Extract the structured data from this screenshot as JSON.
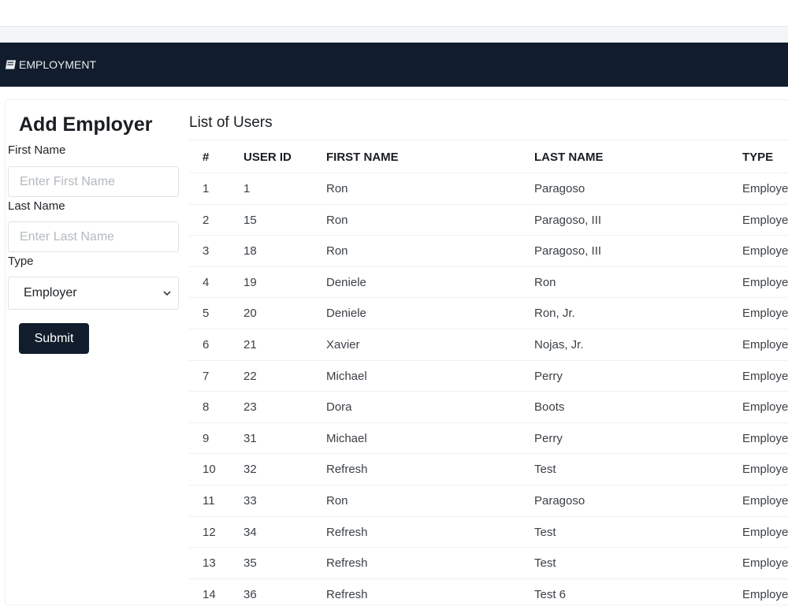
{
  "nav": {
    "brand": "EMPLOYMENT",
    "brand_icon": "book-icon"
  },
  "form": {
    "title": "Add Employer",
    "first_name_label": "First Name",
    "first_name_placeholder": "Enter First Name",
    "last_name_label": "Last Name",
    "last_name_placeholder": "Enter Last Name",
    "type_label": "Type",
    "type_value": "Employer",
    "submit_label": "Submit"
  },
  "list": {
    "title": "List of Users",
    "columns": [
      "#",
      "USER ID",
      "FIRST NAME",
      "LAST NAME",
      "TYPE"
    ],
    "rows": [
      [
        "1",
        "1",
        "Ron",
        "Paragoso",
        "Employee"
      ],
      [
        "2",
        "15",
        "Ron",
        "Paragoso, III",
        "Employee"
      ],
      [
        "3",
        "18",
        "Ron",
        "Paragoso, III",
        "Employee"
      ],
      [
        "4",
        "19",
        "Deniele",
        "Ron",
        "Employee"
      ],
      [
        "5",
        "20",
        "Deniele",
        "Ron, Jr.",
        "Employee"
      ],
      [
        "6",
        "21",
        "Xavier",
        "Nojas, Jr.",
        "Employee"
      ],
      [
        "7",
        "22",
        "Michael",
        "Perry",
        "Employee"
      ],
      [
        "8",
        "23",
        "Dora",
        "Boots",
        "Employee"
      ],
      [
        "9",
        "31",
        "Michael",
        "Perry",
        "Employee"
      ],
      [
        "10",
        "32",
        "Refresh",
        "Test",
        "Employee"
      ],
      [
        "11",
        "33",
        "Ron",
        "Paragoso",
        "Employee"
      ],
      [
        "12",
        "34",
        "Refresh",
        "Test",
        "Employee"
      ],
      [
        "13",
        "35",
        "Refresh",
        "Test",
        "Employee"
      ],
      [
        "14",
        "36",
        "Refresh",
        "Test 6",
        "Employee"
      ]
    ]
  },
  "colors": {
    "navbar": "#111d2c",
    "submit": "#111d2c"
  }
}
